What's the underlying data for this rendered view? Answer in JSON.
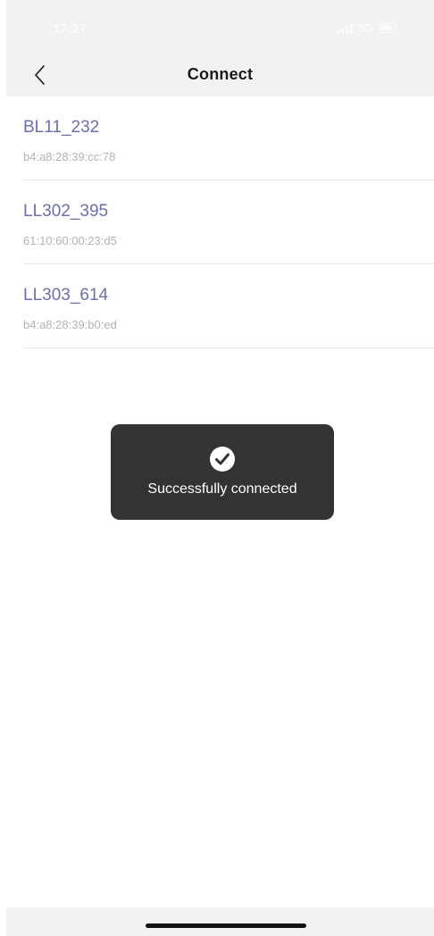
{
  "status_bar": {
    "time": "17:27",
    "network": "5G"
  },
  "nav": {
    "title": "Connect"
  },
  "devices": [
    {
      "name": "BL11_232",
      "mac": "b4:a8:28:39:cc:78"
    },
    {
      "name": "LL302_395",
      "mac": "61:10:60:00:23:d5"
    },
    {
      "name": "LL303_614",
      "mac": "b4:a8:28:39:b0:ed"
    }
  ],
  "toast": {
    "message": "Successfully connected",
    "icon": "check-circle-icon"
  },
  "colors": {
    "device_name": "#6a6fb0",
    "device_mac": "#b3b3b3",
    "toast_background": "#333333",
    "header_background": "#f2f2f2"
  }
}
